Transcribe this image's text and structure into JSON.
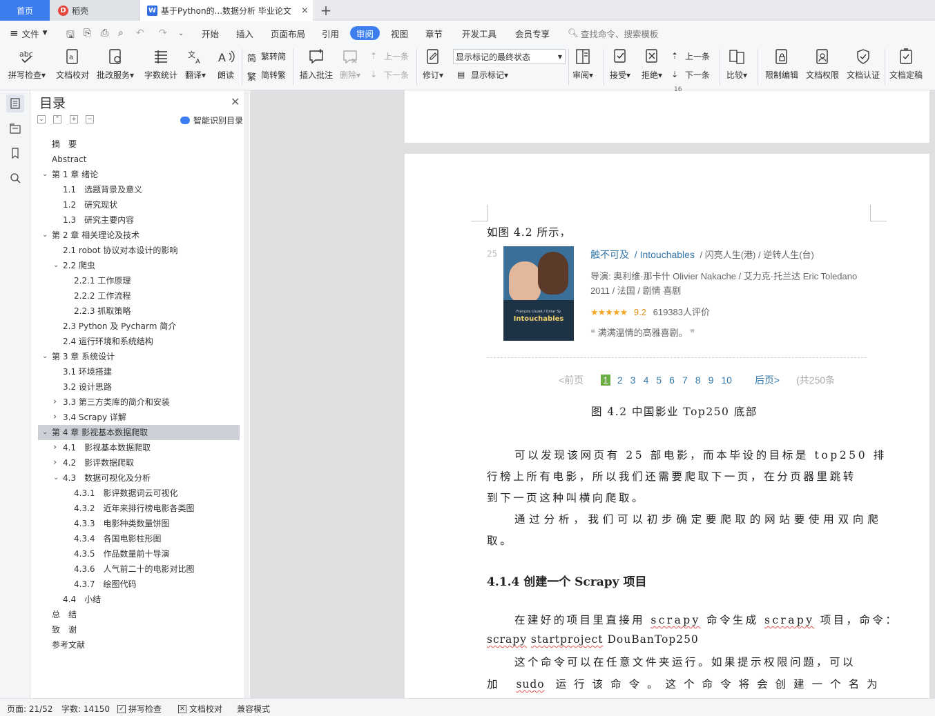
{
  "tabs": {
    "home": "首页",
    "docer": "稻壳",
    "doc": "基于Python的...数据分析 毕业论文",
    "close": "×",
    "add": "+"
  },
  "menubar": {
    "file": "文件",
    "items": [
      "开始",
      "插入",
      "页面布局",
      "引用",
      "审阅",
      "视图",
      "章节",
      "开发工具",
      "会员专享"
    ],
    "active": "审阅",
    "search": "查找命令、搜索模板"
  },
  "ribbon": {
    "spell": "拼写检查",
    "proof": "文档校对",
    "review_service": "批改服务",
    "word_count": "字数统计",
    "translate": "翻译",
    "read_aloud": "朗读",
    "to_traditional": "繁转简",
    "to_simplified": "简转繁",
    "insert_comment": "插入批注",
    "delete": "删除",
    "prev_comment": "上一条",
    "next_comment": "下一条",
    "track": "修订",
    "markup_state": "显示标记的最终状态",
    "show_markup": "显示标记",
    "review_pane": "审阅",
    "accept": "接受",
    "reject": "拒绝",
    "prev_change": "上一条",
    "next_change": "下一条",
    "compare": "比较",
    "restrict": "限制编辑",
    "permissions": "文档权限",
    "certify": "文档认证",
    "finalize": "文档定稿"
  },
  "toc": {
    "title": "目录",
    "smart": "智能识别目录",
    "items": [
      {
        "text": "摘　要"
      },
      {
        "text": "Abstract"
      },
      {
        "text": "第 1 章  绪论"
      },
      {
        "text": "1.1　选题背景及意义"
      },
      {
        "text": "1.2　研究现状"
      },
      {
        "text": "1.3　研究主要内容"
      },
      {
        "text": "第 2 章  相关理论及技术"
      },
      {
        "text": "2.1 robot 协议对本设计的影响"
      },
      {
        "text": "2.2  爬虫"
      },
      {
        "text": "2.2.1  工作原理"
      },
      {
        "text": "2.2.2  工作流程"
      },
      {
        "text": "2.2.3  抓取策略"
      },
      {
        "text": "2.3 Python 及 Pycharm 简介"
      },
      {
        "text": "2.4 运行环境和系统结构"
      },
      {
        "text": "第 3 章  系统设计"
      },
      {
        "text": "3.1 环境搭建"
      },
      {
        "text": "3.2 设计思路"
      },
      {
        "text": "3.3  第三方类库的简介和安装"
      },
      {
        "text": "3.4 Scrapy 详解"
      },
      {
        "text": "第 4 章  影视基本数据爬取"
      },
      {
        "text": "4.1　影视基本数据爬取"
      },
      {
        "text": "4.2　影评数据爬取"
      },
      {
        "text": "4.3　数据可视化及分析"
      },
      {
        "text": "4.3.1　影评数据词云可视化"
      },
      {
        "text": "4.3.2　近年来排行榜电影各类图"
      },
      {
        "text": "4.3.3　电影种类数量饼图"
      },
      {
        "text": "4.3.4　各国电影柱形图"
      },
      {
        "text": "4.3.5　作品数量前十导演"
      },
      {
        "text": "4.3.6　人气前二十的电影对比图"
      },
      {
        "text": "4.3.7　绘图代码"
      },
      {
        "text": "4.4　小结"
      },
      {
        "text": "总　结"
      },
      {
        "text": "致　谢"
      },
      {
        "text": "参考文献"
      }
    ]
  },
  "doc": {
    "page_number": "16",
    "line_intro": "如图 4.2 所示，",
    "movie": {
      "rank": "25",
      "title_cn": "触不可及",
      "title_en": "Intouchables",
      "alt_titles": "闪亮人生(港) / 逆转人生(台)",
      "credits": "导演: 奥利维·那卡什 Olivier Nakache / 艾力克·托兰达 Eric Toledano",
      "info": "2011 / 法国 / 剧情 喜剧",
      "rating": "9.2",
      "votes": "619383人评价",
      "quote": "满满温情的高雅喜剧。",
      "stars": "4.5"
    },
    "poster": {
      "line1": "François Cluzet / Omar Sy",
      "title": "Intouchables"
    },
    "pager": {
      "prev": "<前页",
      "current": "1",
      "pages": [
        "2",
        "3",
        "4",
        "5",
        "6",
        "7",
        "8",
        "9",
        "10"
      ],
      "next": "后页>",
      "total": "(共250条"
    },
    "caption": "图 4.2  中国影业 Top250 底部",
    "p1": [
      "可以发现该网页有 25 部电影，而本毕设的目标是 top250 排",
      "行榜上所有电影，所以我们还需要爬取下一页，在分页器里跳转",
      "到下一页这种叫横向爬取。"
    ],
    "p2": [
      "通过分析，我们可以初步确定要爬取的网站要使用双向爬",
      "取。"
    ],
    "heading": "4.1.4    创建一个 Scrapy 项目",
    "p3a": "在建好的项目里直接用",
    "p3_cmd1": "scrapy",
    "p3b": "命令生成",
    "p3_cmd2": "scrapy",
    "p3c": "项目，命令：",
    "p3_line2a": "scrapy",
    "p3_line2b": "startproject",
    "p3_line2c": "DouBanTop250",
    "p4": "这个命令可以在任意文件夹运行。如果提示权限问题，可以",
    "p5a": "加",
    "p5_sudo": "sudo",
    "p5b": "运行该命令。这个命令将会创建一个名为"
  },
  "status": {
    "page": "页面: 21/52",
    "words": "字数: 14150",
    "spell": "拼写检查",
    "proof": "文档校对",
    "compat": "兼容模式"
  },
  "colors": {
    "accent": "#3c7ef0",
    "link": "#3377aa",
    "pager_green": "#6cad45",
    "star": "#f5a623"
  }
}
